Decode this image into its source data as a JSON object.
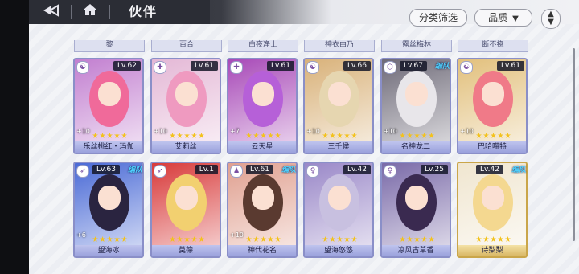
{
  "header": {
    "title": "伙伴",
    "back_icon": "back-arrow-icon",
    "home_icon": "home-icon"
  },
  "controls": {
    "filter_label": "分类筛选",
    "quality_label": "品质",
    "sort_icon": "sort-updown-icon"
  },
  "top_strip_names": [
    "黎",
    "百合",
    "白夜净士",
    "神衣由乃",
    "露丝梅林",
    "断不挠"
  ],
  "team_badge": "编队",
  "cards": [
    {
      "name": "乐丝桃红・玛伽",
      "level": "Lv.62",
      "plus": "+10",
      "stars": 5,
      "element": "☯",
      "in_team": false,
      "hair": "#f06a9a",
      "bg": "#c27fd0",
      "frame": "purple"
    },
    {
      "name": "艾莉丝",
      "level": "Lv.61",
      "plus": "+10",
      "stars": 5,
      "element": "✚",
      "in_team": false,
      "hair": "#ef9ac0",
      "bg": "#e4b8d6",
      "frame": "purple"
    },
    {
      "name": "云天星",
      "level": "Lv.61",
      "plus": "+7",
      "stars": 5,
      "element": "✚",
      "in_team": false,
      "hair": "#b660d8",
      "bg": "#a84ab8",
      "frame": "purple"
    },
    {
      "name": "三千侯",
      "level": "Lv.66",
      "plus": "+10",
      "stars": 5,
      "element": "☯",
      "in_team": false,
      "hair": "#e6d6b0",
      "bg": "#d9b27a",
      "frame": "purple"
    },
    {
      "name": "名神龙二",
      "level": "Lv.67",
      "plus": "+10",
      "stars": 5,
      "element": "⬡",
      "in_team": true,
      "hair": "#e8e6ea",
      "bg": "#6e6a78",
      "frame": "purple"
    },
    {
      "name": "巴哈喵特",
      "level": "Lv.61",
      "plus": "+10",
      "stars": 5,
      "element": "☯",
      "in_team": false,
      "hair": "#f07a88",
      "bg": "#e2c07c",
      "frame": "purple"
    },
    {
      "name": "望海冰",
      "level": "Lv.63",
      "plus": "+6",
      "stars": 5,
      "element": "➶",
      "in_team": true,
      "hair": "#2a2440",
      "bg": "#4a6ad6",
      "frame": "purple"
    },
    {
      "name": "莫德",
      "level": "Lv.1",
      "plus": "",
      "stars": 5,
      "element": "➶",
      "in_team": false,
      "hair": "#f2d070",
      "bg": "#d83a3a",
      "frame": "purple"
    },
    {
      "name": "神代花名",
      "level": "Lv.61",
      "plus": "+10",
      "stars": 5,
      "element": "♟",
      "in_team": true,
      "hair": "#5a3a30",
      "bg": "#e0a090",
      "frame": "purple"
    },
    {
      "name": "望海悠悠",
      "level": "Lv.42",
      "plus": "",
      "stars": 5,
      "element": "♀",
      "in_team": false,
      "hair": "#c8c0e0",
      "bg": "#9a88c8",
      "frame": "purple"
    },
    {
      "name": "凉风古草香",
      "level": "Lv.25",
      "plus": "",
      "stars": 5,
      "element": "♀",
      "in_team": false,
      "hair": "#3a2a50",
      "bg": "#7a6aa8",
      "frame": "purple"
    },
    {
      "name": "诗梨梨",
      "level": "Lv.42",
      "plus": "",
      "stars": 5,
      "element": "",
      "in_team": true,
      "hair": "#f4d890",
      "bg": "#f0e6d0",
      "frame": "gold"
    }
  ]
}
